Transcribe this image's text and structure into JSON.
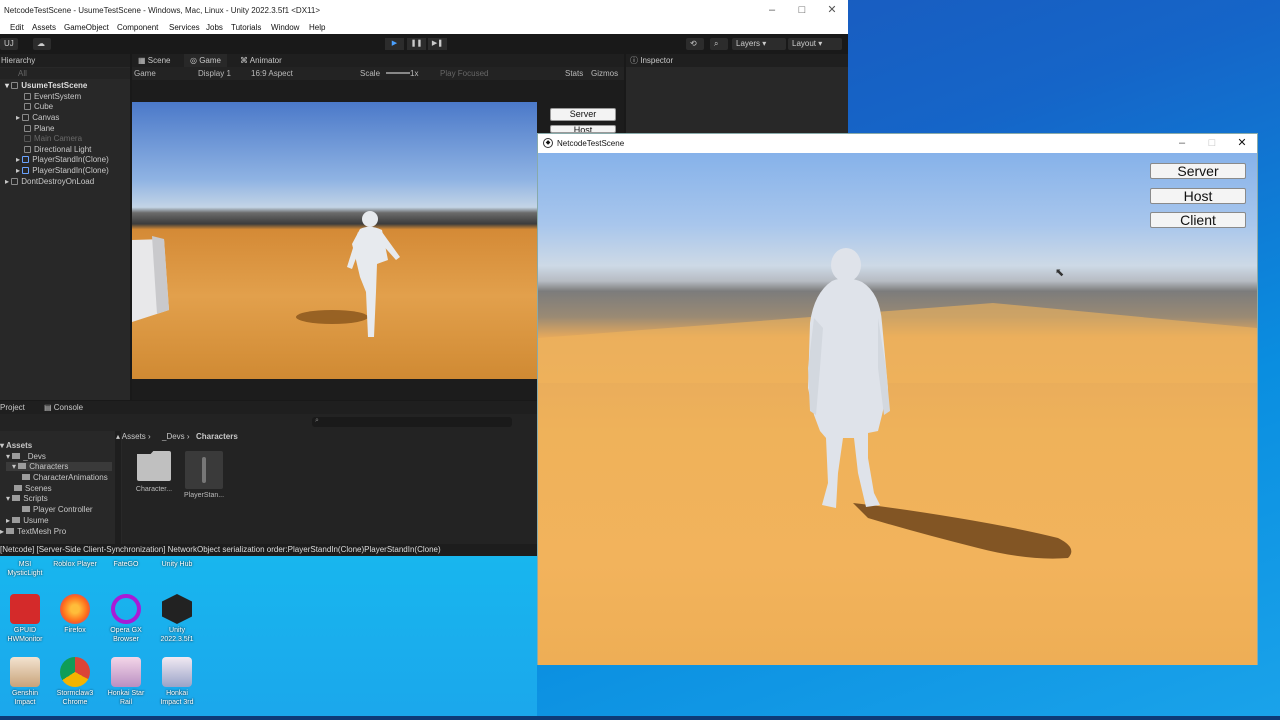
{
  "unity": {
    "title": "NetcodeTestScene - UsumeTestScene - Windows, Mac, Linux - Unity 2022.3.5f1 <DX11>",
    "menu": [
      "Edit",
      "Assets",
      "GameObject",
      "Component",
      "Services",
      "Jobs",
      "Tutorials",
      "Window",
      "Help"
    ],
    "toolbar": {
      "account": "UJ",
      "layers": "Layers",
      "layout": "Layout"
    },
    "hierarchy": {
      "tab": "Hierarchy",
      "search_placeholder": "All",
      "items": [
        {
          "label": "UsumeTestScene"
        },
        {
          "label": "EventSystem"
        },
        {
          "label": "Cube"
        },
        {
          "label": "Canvas"
        },
        {
          "label": "Plane"
        },
        {
          "label": "Main Camera"
        },
        {
          "label": "Directional Light"
        },
        {
          "label": "PlayerStandIn(Clone)"
        },
        {
          "label": "PlayerStandIn(Clone)"
        },
        {
          "label": "DontDestroyOnLoad"
        }
      ]
    },
    "tabs": {
      "scene": "Scene",
      "game": "Game",
      "animator": "Animator",
      "inspector": "Inspector"
    },
    "gamebar": {
      "mode": "Game",
      "display": "Display 1",
      "aspect": "16:9 Aspect",
      "scale": "Scale",
      "scale_value": "1x",
      "play_focused": "Play Focused",
      "stats": "Stats",
      "gizmos": "Gizmos"
    },
    "game_buttons": {
      "server": "Server",
      "host": "Host"
    },
    "project": {
      "tab_project": "Project",
      "tab_console": "Console",
      "breadcrumb": [
        "Assets",
        "_Devs",
        "Characters"
      ],
      "tree": [
        {
          "label": "Assets"
        },
        {
          "label": "_Devs"
        },
        {
          "label": "Characters"
        },
        {
          "label": "CharacterAnimations"
        },
        {
          "label": "Scenes"
        },
        {
          "label": "Scripts"
        },
        {
          "label": "Player Controller"
        },
        {
          "label": "Usume"
        },
        {
          "label": "TextMesh Pro"
        }
      ],
      "assets": [
        {
          "label": "Character..."
        },
        {
          "label": "PlayerStan..."
        }
      ]
    },
    "status": "[Netcode] [Server-Side Client-Synchronization] NetworkObject serialization order:PlayerStandIn(Clone)PlayerStandIn(Clone)"
  },
  "netcode_window": {
    "title": "NetcodeTestScene",
    "buttons": {
      "server": "Server",
      "host": "Host",
      "client": "Client"
    }
  },
  "desktop": {
    "icons_row1": [
      {
        "label": "MSI MysticLight"
      },
      {
        "label": "Roblox Player"
      },
      {
        "label": "FateGO"
      },
      {
        "label": "Unity Hub"
      }
    ],
    "icons_row2": [
      {
        "label": "GPUID HWMonitor"
      },
      {
        "label": "Firefox"
      },
      {
        "label": "Opera GX Browser"
      },
      {
        "label": "Unity 2022.3.5f1"
      }
    ],
    "icons_row3": [
      {
        "label": "Genshin Impact"
      },
      {
        "label": "Stormclaw3 Chrome"
      },
      {
        "label": "Honkai Star Rail"
      },
      {
        "label": "Honkai Impact 3rd"
      }
    ]
  }
}
